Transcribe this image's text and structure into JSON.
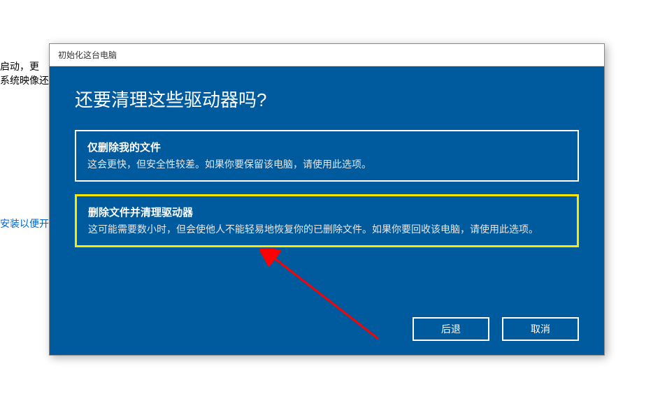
{
  "background": {
    "line1": "启动，更",
    "line2": "系统映像还",
    "link": "安装以便开"
  },
  "dialog": {
    "title": "初始化这台电脑",
    "heading": "还要清理这些驱动器吗?",
    "options": [
      {
        "title": "仅删除我的文件",
        "desc": "这会更快，但安全性较差。如果你要保留该电脑，请使用此选项。"
      },
      {
        "title": "删除文件并清理驱动器",
        "desc": "这可能需要数小时，但会使他人不能轻易地恢复你的已删除文件。如果你要回收该电脑，请使用此选项。"
      }
    ],
    "buttons": {
      "back": "后退",
      "cancel": "取消"
    }
  },
  "annotation": {
    "arrow_color": "#ff0000"
  }
}
